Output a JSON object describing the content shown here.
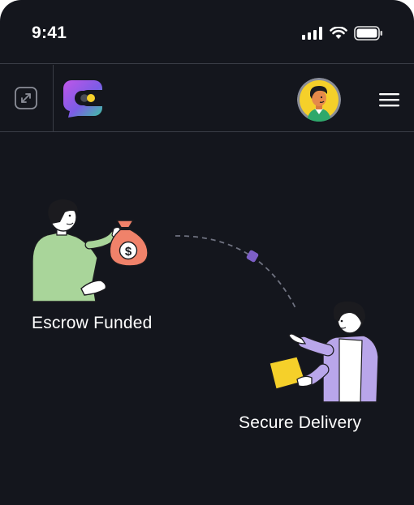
{
  "status_bar": {
    "time": "9:41",
    "icons": [
      "signal-icon",
      "wifi-icon",
      "battery-icon"
    ]
  },
  "app_bar": {
    "expand_icon": "expand-icon",
    "logo": "app-logo",
    "avatar": "user-avatar",
    "menu_icon": "hamburger-menu-icon"
  },
  "steps": [
    {
      "label": "Escrow Funded",
      "icon": "money-bag-icon"
    },
    {
      "label": "Secure Delivery",
      "icon": "package-icon"
    }
  ],
  "colors": {
    "background": "#14161d",
    "divider": "#3a3d46",
    "accent_purple": "#8b5cf6",
    "accent_yellow": "#f5d02a",
    "shirt_green": "#a9d59a",
    "shirt_purple": "#b9a6ea",
    "bag_coral": "#f0826a"
  }
}
